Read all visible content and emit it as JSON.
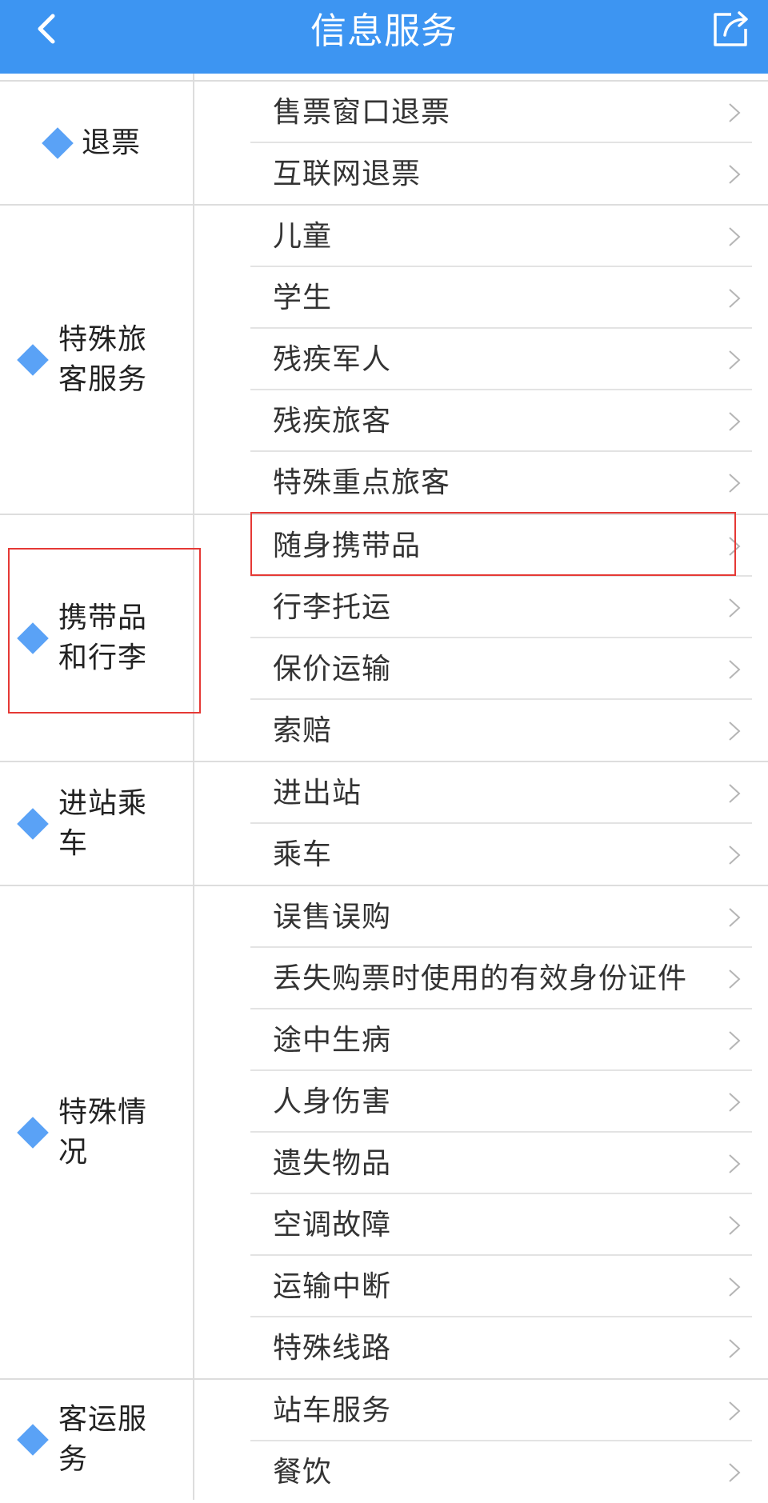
{
  "navbar": {
    "title": "信息服务",
    "back_icon": "chevron-left-icon",
    "share_icon": "share-icon"
  },
  "colors": {
    "navbar_bg": "#3d95f2",
    "diamond": "#5aa2f6",
    "highlight": "#e53935"
  },
  "groups": [
    {
      "label_lines": [
        "退票"
      ],
      "items": [
        "售票窗口退票",
        "互联网退票"
      ]
    },
    {
      "label_lines": [
        "特殊旅",
        "客服务"
      ],
      "items": [
        "儿童",
        "学生",
        "残疾军人",
        "残疾旅客",
        "特殊重点旅客"
      ]
    },
    {
      "label_lines": [
        "携带品",
        "和行李"
      ],
      "items": [
        "随身携带品",
        "行李托运",
        "保价运输",
        "索赔"
      ]
    },
    {
      "label_lines": [
        "进站乘",
        "车"
      ],
      "items": [
        "进出站",
        "乘车"
      ]
    },
    {
      "label_lines": [
        "特殊情",
        "况"
      ],
      "items": [
        "误售误购",
        "丢失购票时使用的有效身份证件",
        "途中生病",
        "人身伤害",
        "遗失物品",
        "空调故障",
        "运输中断",
        "特殊线路"
      ]
    },
    {
      "label_lines": [
        "客运服",
        "务"
      ],
      "items": [
        "站车服务",
        "餐饮"
      ]
    }
  ]
}
